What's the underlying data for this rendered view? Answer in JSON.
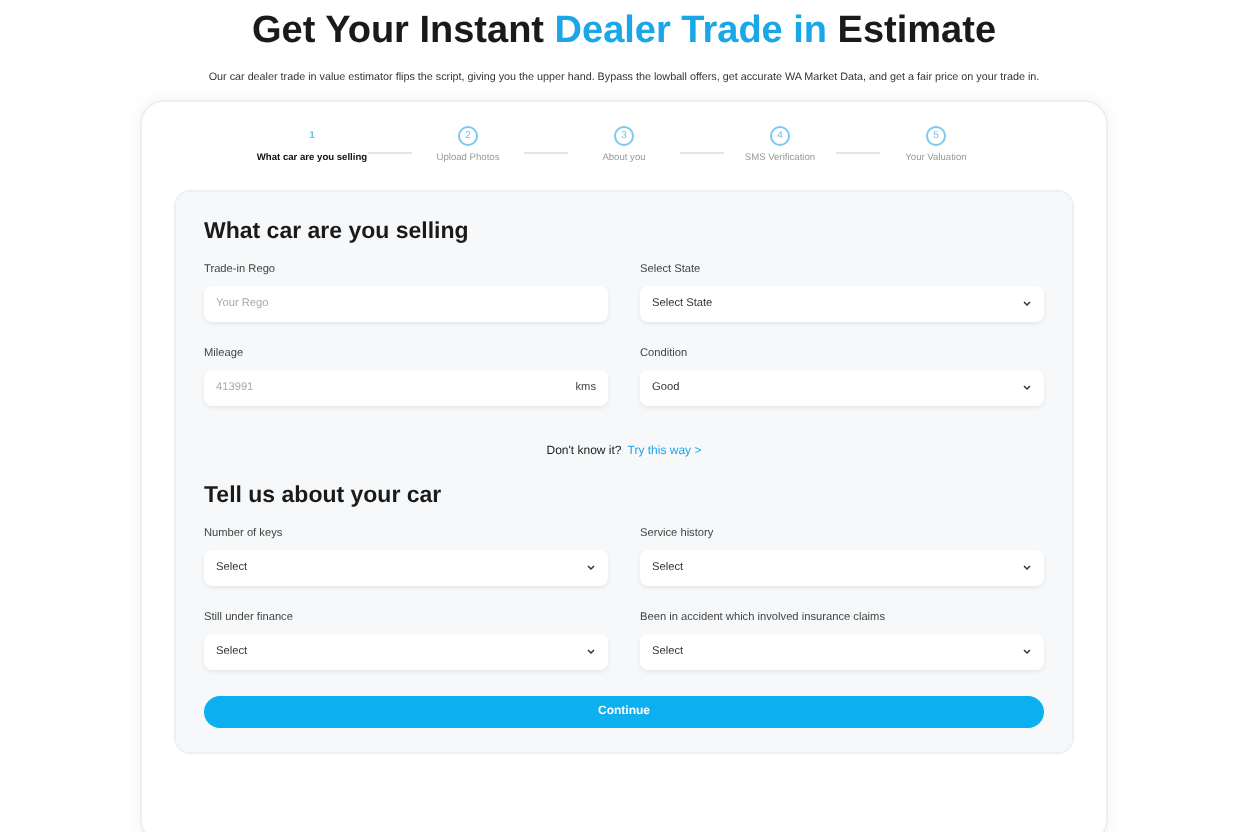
{
  "heading": {
    "before": "Get Your Instant ",
    "highlight": "Dealer Trade in",
    "after": " Estimate"
  },
  "intro": "Our car dealer trade in value estimator flips the script, giving you the upper hand. Bypass the lowball offers, get accurate WA Market Data, and get a fair price on your trade in.",
  "steps": [
    {
      "number": "1",
      "label": "What car are you selling",
      "selected": true
    },
    {
      "number": "2",
      "label": "Upload Photos",
      "selected": false
    },
    {
      "number": "3",
      "label": "About you",
      "selected": false
    },
    {
      "number": "4",
      "label": "SMS Verification",
      "selected": false
    },
    {
      "number": "5",
      "label": "Your Valuation",
      "selected": false
    }
  ],
  "sections": [
    {
      "title": "What car are you selling",
      "fields": [
        {
          "kind": "input",
          "label": "Trade-in Rego",
          "placeholder": "Your Rego"
        },
        {
          "kind": "select",
          "label": "Select State",
          "value": "Select State"
        },
        {
          "kind": "input",
          "label": "Mileage",
          "placeholder": "413991",
          "suffix": "kms"
        },
        {
          "kind": "select",
          "label": "Condition",
          "value": "Good"
        }
      ],
      "help": {
        "text": "Don't know it?",
        "link": "Try this way >"
      }
    },
    {
      "title": "Tell us about your car",
      "fields": [
        {
          "kind": "select",
          "label": "Number of keys",
          "value": "Select"
        },
        {
          "kind": "select",
          "label": "Service history",
          "value": "Select"
        },
        {
          "kind": "select",
          "label": "Still under finance",
          "value": "Select"
        },
        {
          "kind": "select",
          "label": "Been in accident which involved insurance claims",
          "value": "Select"
        }
      ]
    }
  ],
  "continue_button": "Continue"
}
